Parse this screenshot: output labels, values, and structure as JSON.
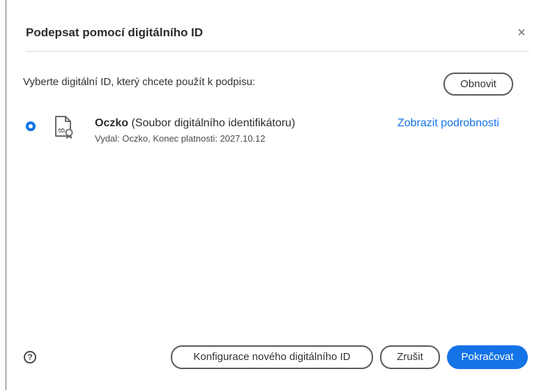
{
  "dialog": {
    "title": "Podepsat pomocí digitálního ID",
    "close_symbol": "×"
  },
  "prompt": "Vyberte digitální ID, který chcete použít k podpisu:",
  "refresh_label": "Obnovit",
  "digital_ids": [
    {
      "name": "Oczko",
      "type": "(Soubor digitálního identifikátoru)",
      "details": "Vydal: Oczko, Konec platnosti: 2027.10.12",
      "selected": true,
      "icon": "certificate-file-icon"
    }
  ],
  "details_link": "Zobrazit podrobnosti",
  "help_symbol": "?",
  "footer": {
    "configure_label": "Konfigurace nového digitálního ID",
    "cancel_label": "Zrušit",
    "continue_label": "Pokračovat"
  },
  "colors": {
    "accent": "#1473e6",
    "text": "#2c2c2c",
    "border": "#5a5a5a"
  }
}
